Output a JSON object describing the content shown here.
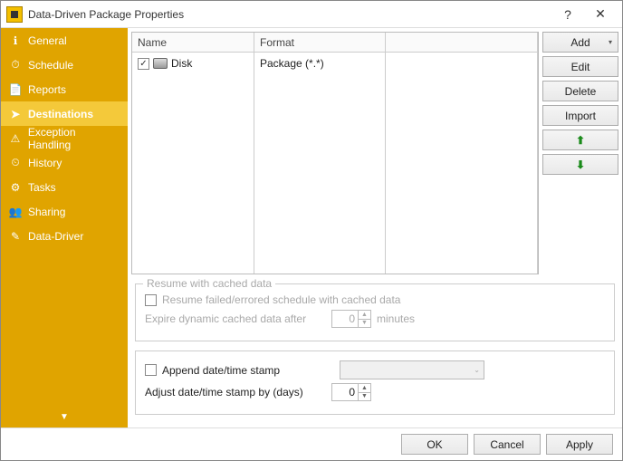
{
  "title": "Data-Driven Package Properties",
  "sidebar": {
    "items": [
      {
        "label": "General",
        "icon": "ℹ"
      },
      {
        "label": "Schedule",
        "icon": "⏱"
      },
      {
        "label": "Reports",
        "icon": "📄"
      },
      {
        "label": "Destinations",
        "icon": "➤",
        "active": true
      },
      {
        "label": "Exception Handling",
        "icon": "⚠"
      },
      {
        "label": "History",
        "icon": "⏲"
      },
      {
        "label": "Tasks",
        "icon": "⚙"
      },
      {
        "label": "Sharing",
        "icon": "👥"
      },
      {
        "label": "Data-Driver",
        "icon": "✎"
      }
    ]
  },
  "grid": {
    "headers": {
      "name": "Name",
      "format": "Format"
    },
    "rows": [
      {
        "checked": true,
        "name": "Disk",
        "format": "Package (*.*)"
      }
    ]
  },
  "buttons": {
    "add": "Add",
    "edit": "Edit",
    "delete": "Delete",
    "import": "Import"
  },
  "resume": {
    "legend": "Resume with cached data",
    "resume_failed_label": "Resume failed/errored schedule with cached data",
    "expire_label": "Expire dynamic cached data after",
    "expire_value": "0",
    "expire_unit": "minutes"
  },
  "stamp": {
    "append_label": "Append date/time stamp",
    "adjust_label": "Adjust date/time stamp by (days)",
    "adjust_value": "0"
  },
  "footer": {
    "ok": "OK",
    "cancel": "Cancel",
    "apply": "Apply"
  }
}
